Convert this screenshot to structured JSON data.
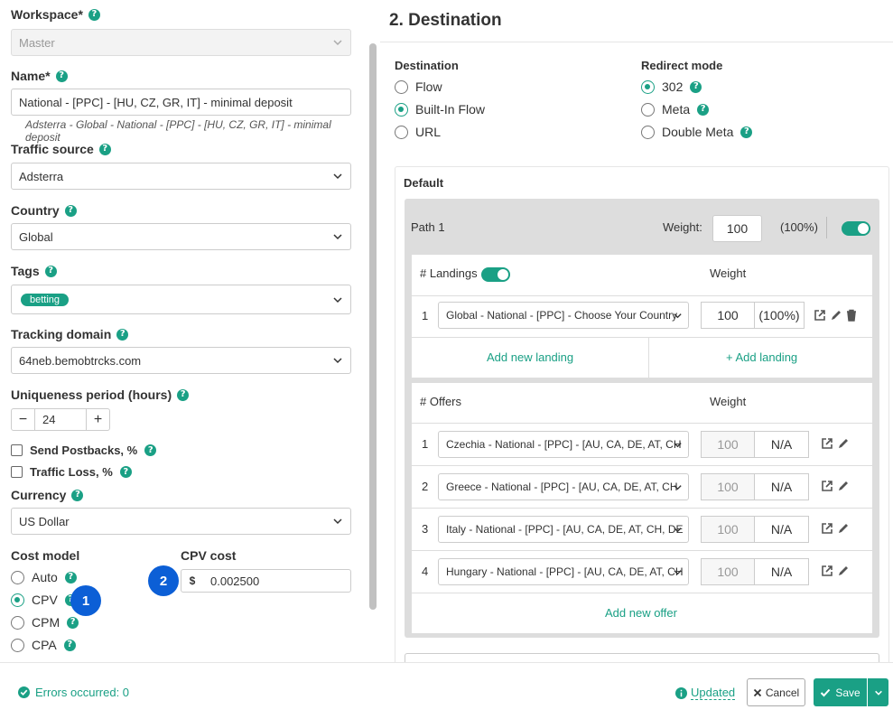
{
  "left": {
    "workspace": {
      "label": "Workspace*",
      "value": "Master"
    },
    "name": {
      "label": "Name*",
      "value": "National - [PPC] - [HU, CZ, GR, IT] - minimal deposit",
      "hint": "Adsterra - Global - National - [PPC] - [HU, CZ, GR, IT] - minimal deposit"
    },
    "traffic_source": {
      "label": "Traffic source",
      "value": "Adsterra"
    },
    "country": {
      "label": "Country",
      "value": "Global"
    },
    "tags": {
      "label": "Tags",
      "pill": "betting"
    },
    "tracking_domain": {
      "label": "Tracking domain",
      "value": "64neb.bemobtrcks.com"
    },
    "uniqueness": {
      "label": "Uniqueness period (hours)",
      "value": "24",
      "minus": "−",
      "plus": "+"
    },
    "send_postbacks": {
      "label": "Send Postbacks, %"
    },
    "traffic_loss": {
      "label": "Traffic Loss, %"
    },
    "currency": {
      "label": "Currency",
      "value": "US Dollar"
    },
    "cost_model": {
      "label": "Cost model",
      "options": [
        "Auto",
        "CPV",
        "CPM",
        "CPA"
      ],
      "selected": "CPV"
    },
    "cpv_cost": {
      "label": "CPV cost",
      "currency_symbol": "$",
      "value": "0.002500"
    },
    "badge1": "1",
    "badge2": "2",
    "help_glyph": "?"
  },
  "right": {
    "title": "2. Destination",
    "destination": {
      "label": "Destination",
      "options": [
        "Flow",
        "Built-In Flow",
        "URL"
      ],
      "selected": "Built-In Flow"
    },
    "redirect": {
      "label": "Redirect mode",
      "options": [
        "302",
        "Meta",
        "Double Meta"
      ],
      "selected": "302"
    },
    "default_label": "Default",
    "path": {
      "name": "Path 1",
      "weight_label": "Weight:",
      "weight": "100",
      "percent": "(100%)"
    },
    "landings": {
      "header": "# Landings",
      "weight_header": "Weight",
      "rows": [
        {
          "n": "1",
          "name": "Global - National - [PPC] - Choose Your Country",
          "weight": "100",
          "percent": "(100%)"
        }
      ],
      "add_new": "Add new landing",
      "add": "+ Add landing"
    },
    "offers": {
      "header": "# Offers",
      "weight_header": "Weight",
      "rows": [
        {
          "n": "1",
          "name": "Czechia - National - [PPC] - [AU, CA, DE, AT, CH",
          "weight": "100",
          "share": "N/A"
        },
        {
          "n": "2",
          "name": "Greece - National - [PPC] - [AU, CA, DE, AT, CH",
          "weight": "100",
          "share": "N/A"
        },
        {
          "n": "3",
          "name": "Italy - National - [PPC] - [AU, CA, DE, AT, CH, DE",
          "weight": "100",
          "share": "N/A"
        },
        {
          "n": "4",
          "name": "Hungary - National - [PPC] - [AU, CA, DE, AT, CH",
          "weight": "100",
          "share": "N/A"
        }
      ],
      "add_new": "Add new offer"
    }
  },
  "footer": {
    "errors": "Errors occurred: 0",
    "updated": "Updated",
    "cancel": "Cancel",
    "save": "Save"
  },
  "colors": {
    "accent": "#1aa085",
    "badge": "#0c5fd6"
  }
}
